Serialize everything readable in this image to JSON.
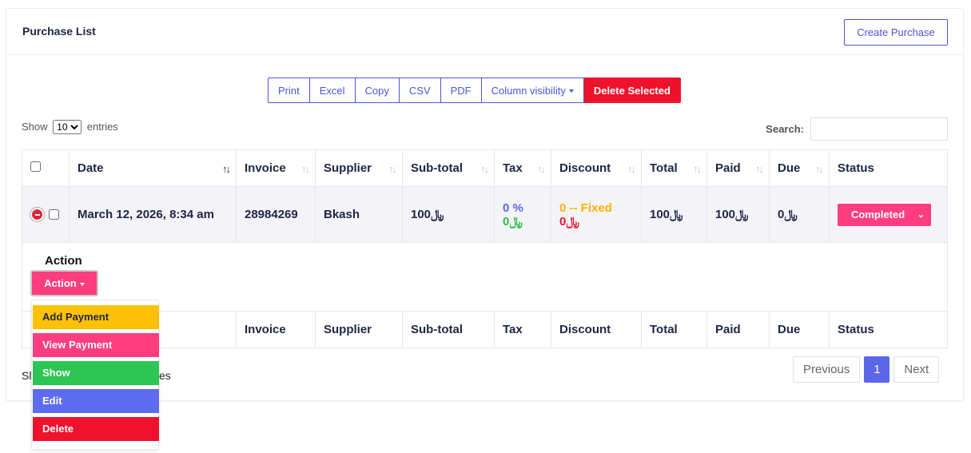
{
  "card": {
    "title": "Purchase List",
    "create_label": "Create Purchase"
  },
  "toolbar": {
    "buttons": [
      "Print",
      "Excel",
      "Copy",
      "CSV",
      "PDF"
    ],
    "column_visibility": "Column visibility",
    "delete_selected": "Delete Selected"
  },
  "length": {
    "show": "Show",
    "value": "10",
    "entries": "entries"
  },
  "search": {
    "label": "Search:",
    "value": ""
  },
  "columns": [
    "Date",
    "Invoice",
    "Supplier",
    "Sub-total",
    "Tax",
    "Discount",
    "Total",
    "Paid",
    "Due",
    "Status"
  ],
  "row": {
    "date": "March 12, 2026, 8:34 am",
    "invoice": "28984269",
    "supplier": "Bkash",
    "subtotal": "100﷼",
    "tax_rate": "0 %",
    "tax_amount": "0﷼",
    "discount_type": "0 -- Fixed",
    "discount_amount": "0﷼",
    "total": "100﷼",
    "paid": "100﷼",
    "due": "0﷼",
    "status": "Completed"
  },
  "child": {
    "action_label": "Action",
    "action_button": "Action"
  },
  "menu": [
    "Add Payment",
    "View Payment",
    "Show",
    "Edit",
    "Delete"
  ],
  "info": {
    "left": "Sl",
    "right": "es"
  },
  "pagination": {
    "previous": "Previous",
    "page": "1",
    "next": "Next"
  },
  "colors": {
    "accent": "#4b56d2",
    "danger": "#f0122d",
    "pink": "#ff3d7f",
    "warning": "#ffc107",
    "success": "#2dc653"
  }
}
